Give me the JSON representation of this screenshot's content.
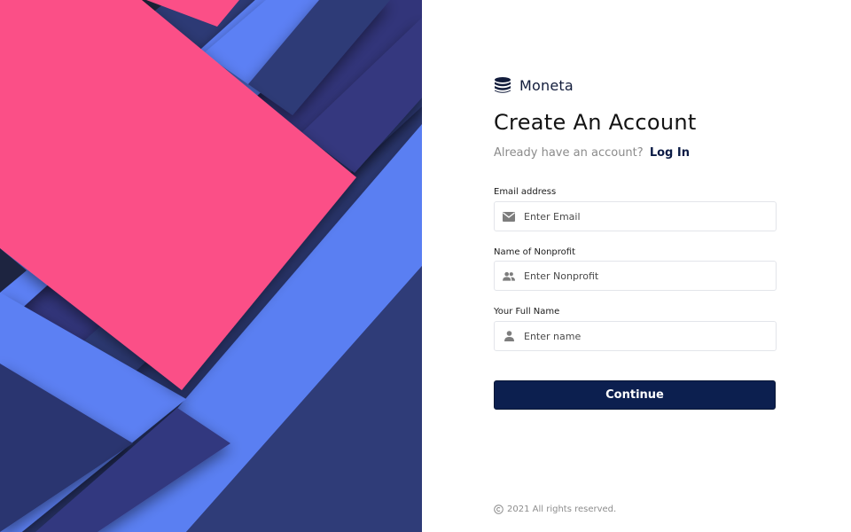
{
  "brand": {
    "name": "Moneta",
    "icon": "database-stack-icon"
  },
  "heading": "Create An Account",
  "subtitle": {
    "text": "Already have an account?",
    "link_label": "Log In"
  },
  "form": {
    "email": {
      "label": "Email address",
      "placeholder": "Enter Email",
      "value": "",
      "icon": "mail-icon"
    },
    "nonprofit": {
      "label": "Name of Nonprofit",
      "placeholder": "Enter Nonprofit",
      "value": "",
      "icon": "people-icon"
    },
    "full_name": {
      "label": "Your Full Name",
      "placeholder": "Enter name",
      "value": "",
      "icon": "person-icon"
    },
    "continue_label": "Continue"
  },
  "footer": {
    "text": "2021 All rights reserved.",
    "icon": "copyright-icon"
  },
  "colors": {
    "accent": "#0c1f4f",
    "pink": "#fb4f87",
    "blue": "#5a80f3",
    "navy": "#2c3a74",
    "dark": "#1c2340"
  }
}
